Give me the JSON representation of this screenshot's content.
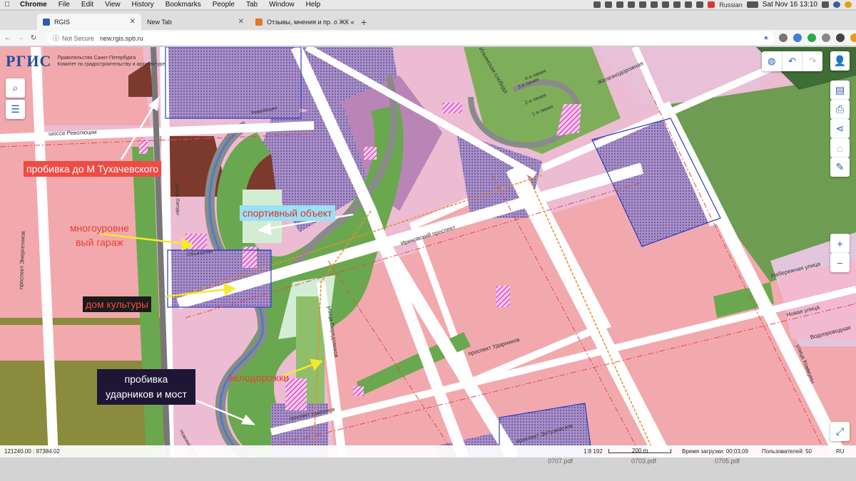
{
  "menubar": {
    "items": [
      "Chrome",
      "File",
      "Edit",
      "View",
      "History",
      "Bookmarks",
      "People",
      "Tab",
      "Window",
      "Help"
    ],
    "language": "Russian",
    "clock": "Sat Nov 16  13:10"
  },
  "tabs": [
    {
      "title": "RGIS",
      "active": true
    },
    {
      "title": "New Tab",
      "active": false
    },
    {
      "title": "Отзывы, мнения и пр. о ЖК «",
      "active": false
    }
  ],
  "address": {
    "security": "Not Secure",
    "url": "new.rgis.spb.ru"
  },
  "app": {
    "logo_text": "РГИС",
    "gov_line1": "Правительство Санкт-Петербурга",
    "gov_line2": "Комитет по градостроительству и архитектуре"
  },
  "map_labels": {
    "shosse": "шоссе Революции",
    "energetikov": "проспект Энергетиков",
    "irinovsky": "Ириновский проспект",
    "udarnikov": "проспект Ударников",
    "entuziastov": "проспект Энтузиастов",
    "novaya": "Новая улица",
    "vodoprovodnaya": "Водопроводная",
    "kommuny": "улица Коммуны",
    "peredovikov": "улица Передовиков",
    "lines": [
      "4-я линия",
      "3-я линия",
      "2-я линия",
      "1-я линия"
    ],
    "naberezhnaya": "Набережная улица",
    "zheleznodorozhnaya": "Железнодорожная",
    "ilyinskaya": "Ильинская слобода",
    "legat": "улица Лагоды",
    "obyezdnaya": "Объездная",
    "udarnikov_short": "проспект Ударников",
    "revolyutsii": "Революции",
    "novomalinovskaya": "Новомалиновская"
  },
  "annotations": {
    "metro": "пробивка до М Тухачевского",
    "sport": "спортивный объект",
    "garage": "многоуровне\nвый гараж",
    "culture": "дом культуры",
    "bike": "велодорожки",
    "bridge": "пробивка ударников и мост"
  },
  "status": {
    "coords": "121240.00 : 97384.02",
    "scale": "1:8 192",
    "scale_bar": "200 m",
    "load_time": "Время загрузки: 00:03,09",
    "users": "Пользователей: 50",
    "lang": "RU"
  },
  "dock": {
    "files": [
      "0707.pdf",
      "0703.pdf",
      "0705.pdf"
    ]
  },
  "colors": {
    "residential": "#f1abb0",
    "mixed": "#ebbcd4",
    "green": "#6aa84f",
    "dark_green": "#7f8c3a",
    "brown": "#7c3a2d",
    "purple": "#b07cb0",
    "annotation_red": "#ee4b44"
  }
}
